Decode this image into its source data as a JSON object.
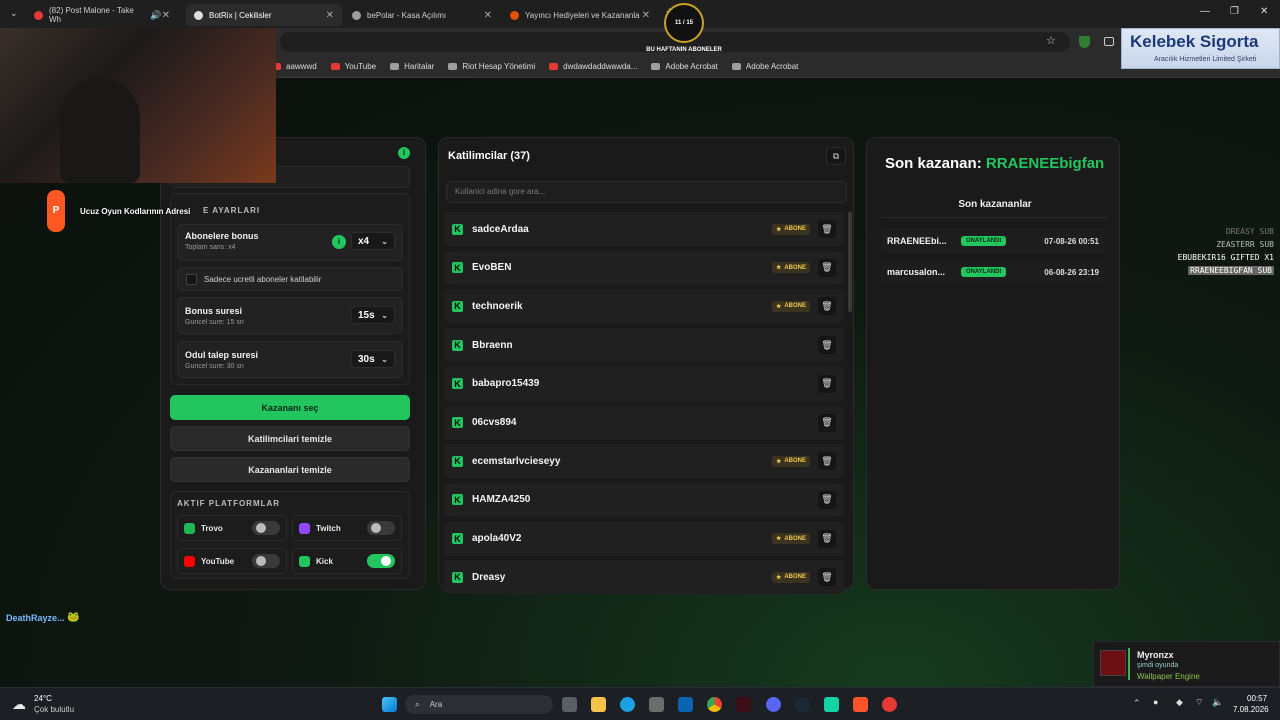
{
  "browser": {
    "tabs": [
      {
        "label": "(82) Post Malone - Take Wh",
        "fav_color": "#e53935"
      },
      {
        "label": "BotRix | Cekilisler",
        "fav_color": "#dddddd"
      },
      {
        "label": "bePolar - Kasa Açılımı",
        "fav_color": "#9e9e9e"
      },
      {
        "label": "Yayıncı Hediyeleri ve Kazananla",
        "fav_color": "#e65100"
      }
    ],
    "new_tab": "+",
    "bookmarks": [
      "aawwwd",
      "YouTube",
      "Haritalar",
      "Riot Hesap Yönetimi",
      "dwdawdaddwawda...",
      "Adobe Acrobat",
      "Adobe Acrobat"
    ]
  },
  "overlay": {
    "counter": "11 / 15",
    "counter_caption": "BU HAFTANIN ABONELER",
    "sponsor_title": "Kelebek Sigorta",
    "sponsor_sub": "Aracılık Hizmetleri Limited Şirketi",
    "promo_text": "Ucuz Oyun Kodlarının Adresi",
    "chat_user": "DeathRayze...",
    "subs_feed": [
      "DREASY SUB",
      "ZEASTERR SUB",
      "EBUBEKIR16 GIFTED X1",
      "RRAENEEBIGFAN SUB"
    ]
  },
  "settings": {
    "section_title": "E AYARLARI",
    "bonus_label": "Abonelere bonus",
    "bonus_sub": "Toplam sans: x4",
    "bonus_value": "x4",
    "paid_only_label": "Sadece ucretli aboneler katilabilir",
    "bonus_time_label": "Bonus suresi",
    "bonus_time_sub": "Guncel sure: 15 sn",
    "bonus_time_value": "15s",
    "claim_time_label": "Odul talep suresi",
    "claim_time_sub": "Guncel sure: 30 sn",
    "claim_time_value": "30s",
    "pick_winner": "Kazananı seç",
    "clear_participants": "Katilimcilari temizle",
    "clear_winners": "Kazananlari temizle",
    "platforms_title": "AKTIF PLATFORMLAR",
    "platforms": [
      {
        "name": "Trovo",
        "on": false,
        "color": "#1db954"
      },
      {
        "name": "Twitch",
        "on": false,
        "color": "#9146ff"
      },
      {
        "name": "YouTube",
        "on": false,
        "color": "#ff0000"
      },
      {
        "name": "Kick",
        "on": true,
        "color": "#22c55e"
      }
    ]
  },
  "participants": {
    "title": "Katilimcilar (37)",
    "search_placeholder": "Kullanici adina gore ara...",
    "abone_label": "ABONE",
    "rows": [
      {
        "name": "sadceArdaa",
        "abone": true
      },
      {
        "name": "EvoBEN",
        "abone": true
      },
      {
        "name": "technoerik",
        "abone": true
      },
      {
        "name": "Bbraenn",
        "abone": false
      },
      {
        "name": "babapro15439",
        "abone": false
      },
      {
        "name": "06cvs894",
        "abone": false
      },
      {
        "name": "ecemstarlvcieseyy",
        "abone": true
      },
      {
        "name": "HAMZA4250",
        "abone": false
      },
      {
        "name": "apola40V2",
        "abone": true
      },
      {
        "name": "Dreasy",
        "abone": true
      }
    ]
  },
  "winners": {
    "last_winner_prefix": "Son kazanan:",
    "last_winner_name": "RRAENEEbigfan",
    "list_title": "Son kazananlar",
    "approved_label": "ONAYLANDI",
    "rows": [
      {
        "name": "RRAENEEbi...",
        "date": "07-08-26 00:51"
      },
      {
        "name": "marcusalon...",
        "date": "06-08-26 23:19"
      }
    ]
  },
  "notification": {
    "user": "Myronzx",
    "status": "şimdi oyunda",
    "game": "Wallpaper Engine"
  },
  "taskbar": {
    "temp": "24°C",
    "weather": "Çok bulutlu",
    "search_placeholder": "Ara",
    "time": "00:57",
    "date": "7.08.2026"
  },
  "colors": {
    "accent": "#22c55e",
    "gold": "#f2c94c"
  }
}
